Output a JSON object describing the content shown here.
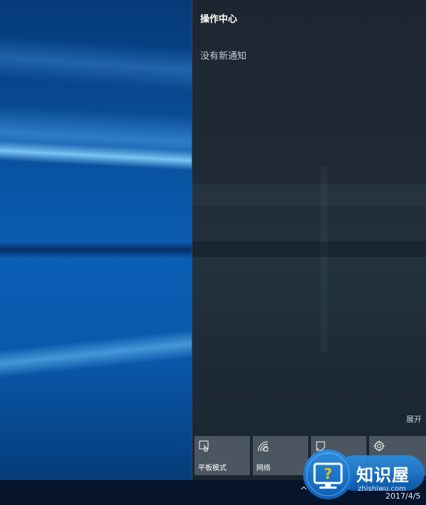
{
  "action_center": {
    "title": "操作中心",
    "no_notifications": "没有新通知",
    "expand_label": "展开",
    "quick_actions": [
      {
        "label": "平板模式",
        "icon": "tablet-mode-icon"
      },
      {
        "label": "网络",
        "icon": "network-icon"
      },
      {
        "label": "",
        "icon": "note-icon"
      },
      {
        "label": "",
        "icon": "settings-icon"
      }
    ]
  },
  "taskbar": {
    "date": "2017/4/5",
    "tray_chevron": "^"
  },
  "watermark": {
    "brand": "知识屋",
    "url": "zhishiwu.com"
  },
  "colors": {
    "panel_bg": "#1f2a35",
    "tile_bg": "#4c5660",
    "desktop_blue": "#0b5fb6",
    "watermark_blue": "#1a7ad4"
  }
}
